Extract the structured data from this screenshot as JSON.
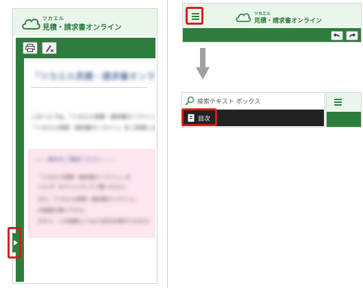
{
  "logo": {
    "kana": "ツカエル",
    "product": "見積・請求書オンライン"
  },
  "left_panel": {
    "doc_title": "「ツカエル見積・請求書オンライン」",
    "paragraph1": "このヘルプは、「ツカエル見積・請求書オンライン」の操作方法を説明しています。",
    "paragraph2": "「ツカエル見積・請求書オンライン」をご利用になる前にお読みください。",
    "notice_title": "―― 基本をご確認ください ――",
    "notice_lines": [
      "「ツカエル見積・請求書オンライン」の",
      "ヘルプ）をクリックしてご覧ください。",
      "また、「ツカエル見積・請求書オンライン」",
      "の画面を開いてから、",
      "ボタン、この画面に(→)より目次を表示できます。"
    ]
  },
  "right_panel": {
    "search_placeholder": "検索テキスト ボックス",
    "toc_label": "目次"
  },
  "colors": {
    "brand_green": "#2e7d3e",
    "header_bg": "#e8f5e9",
    "highlight": "#e01818"
  },
  "icons": [
    "cloud-logo-icon",
    "print-icon",
    "annotate-icon",
    "expand-arrow-icon",
    "hamburger-menu-icon",
    "back-arrow-icon",
    "forward-arrow-icon",
    "down-arrow-icon",
    "search-icon",
    "toc-book-icon"
  ]
}
